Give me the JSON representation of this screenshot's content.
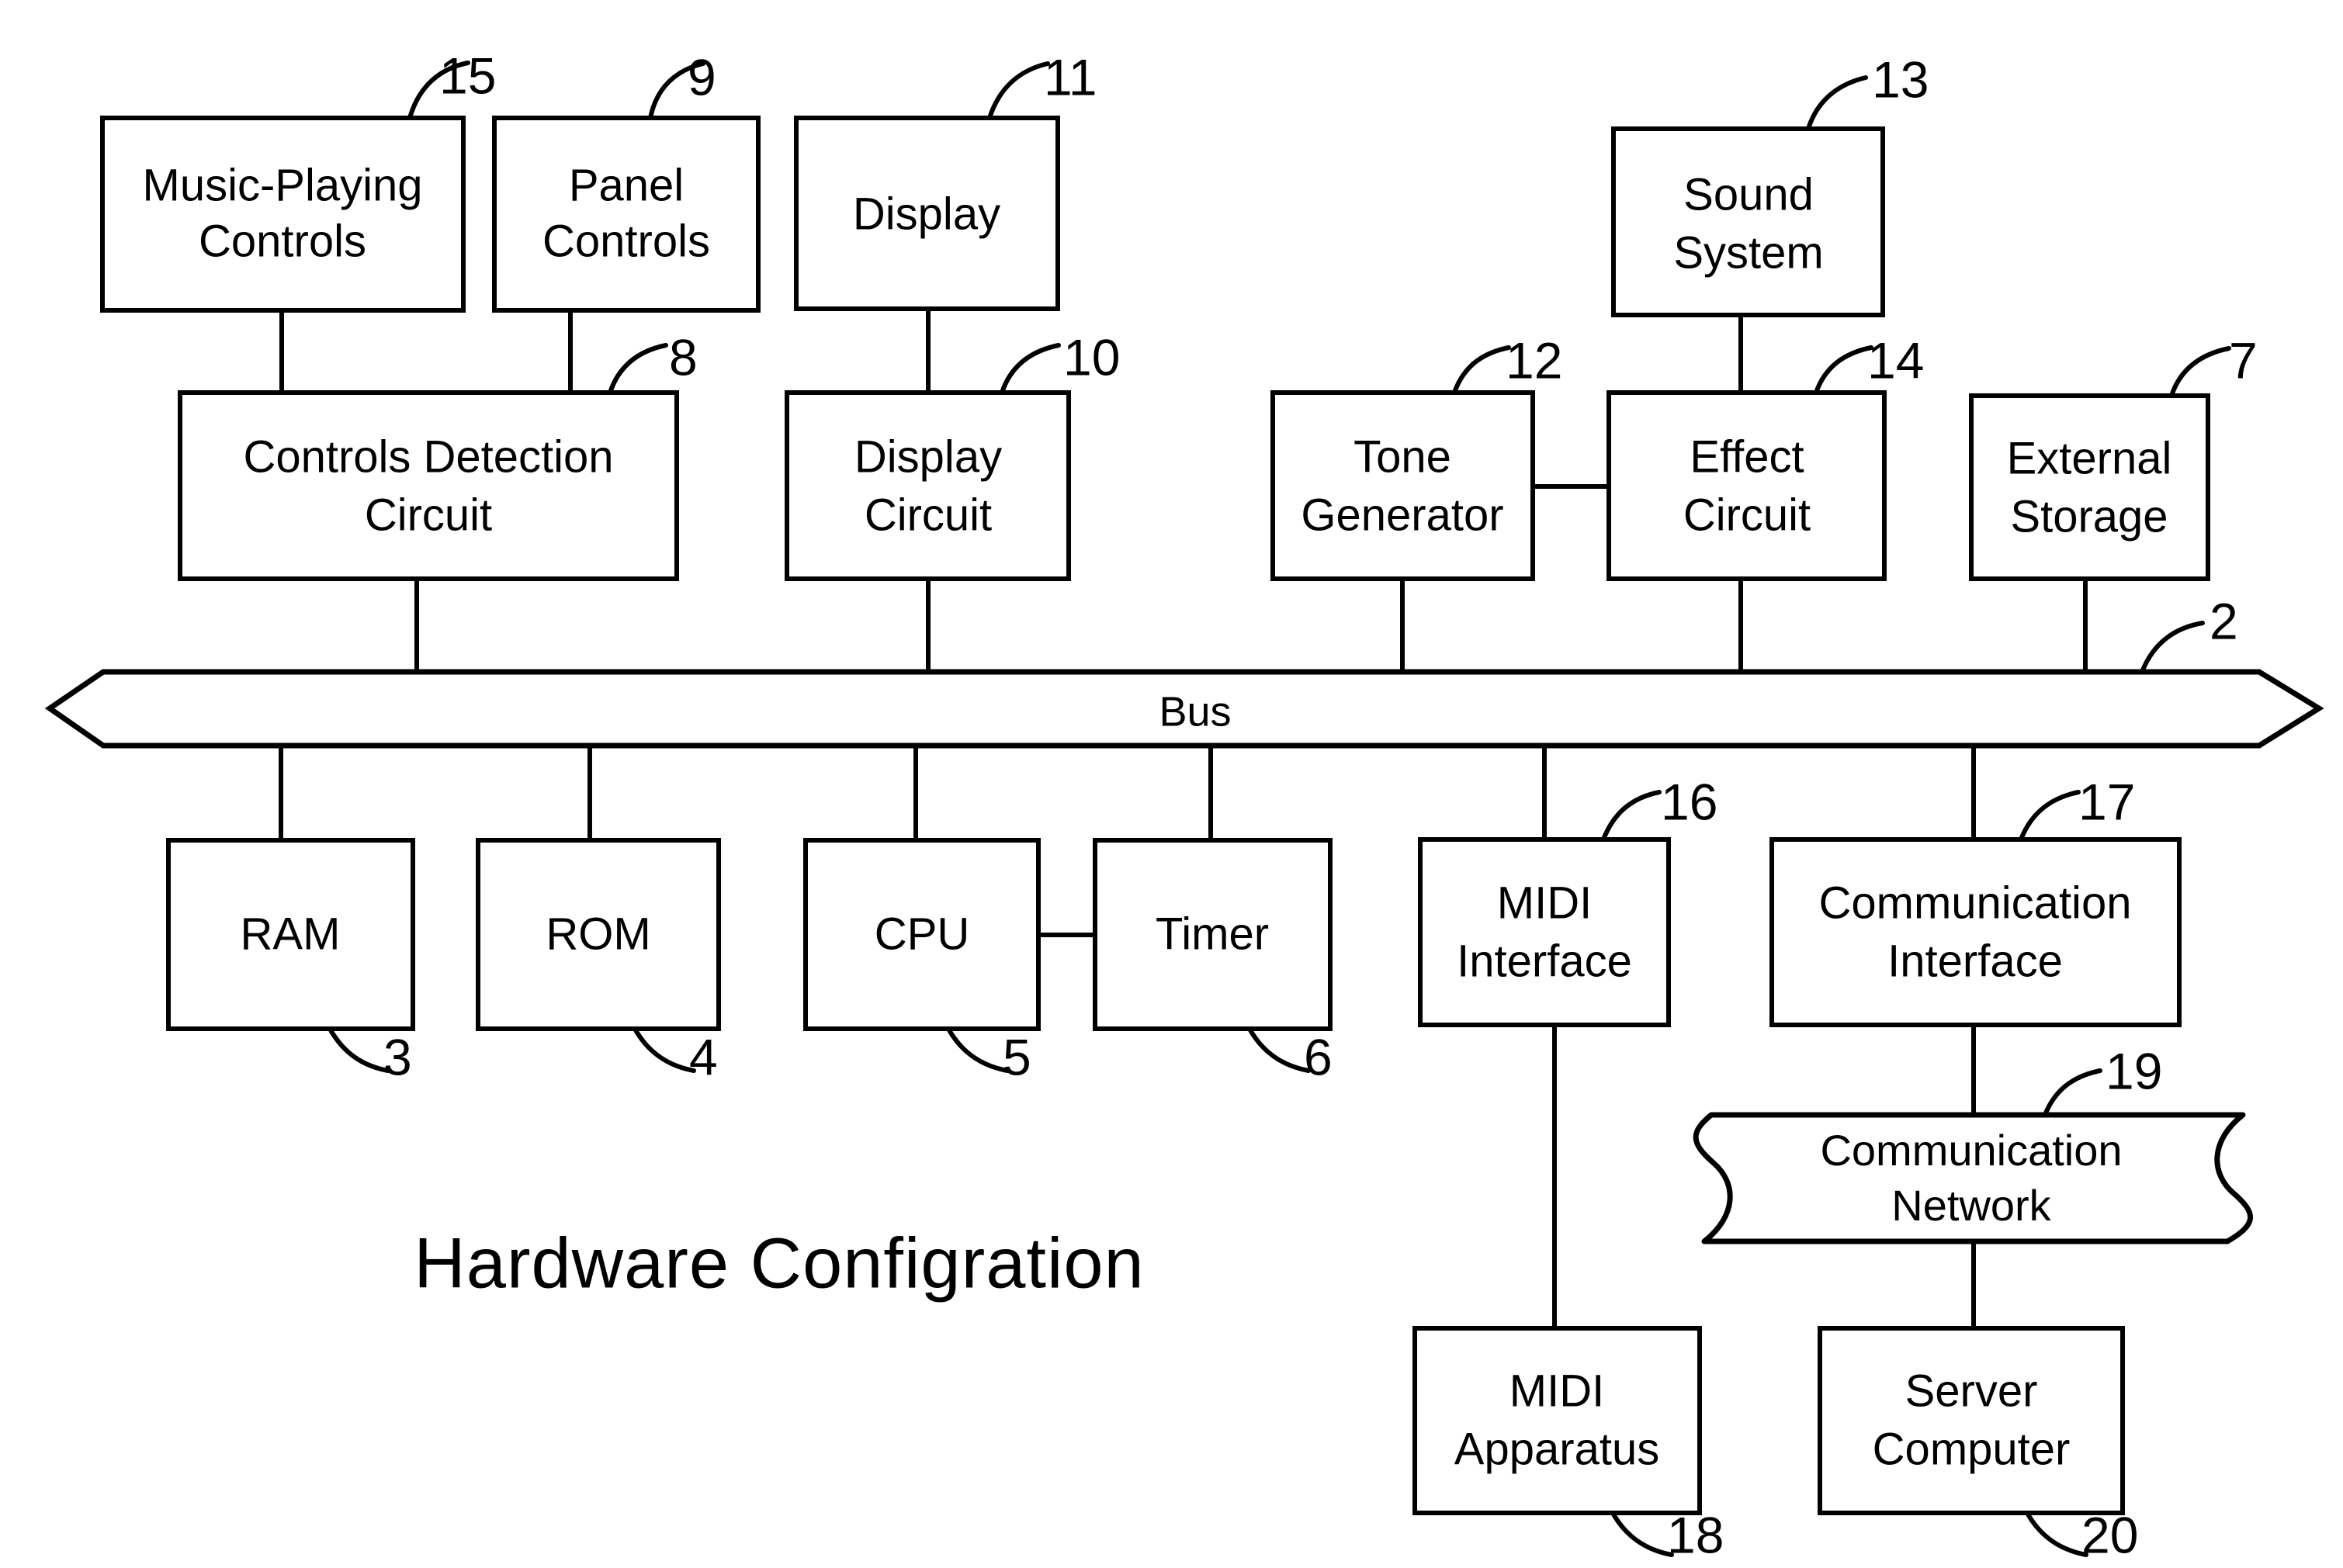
{
  "figure": {
    "caption": "Hardware Configration",
    "stroke_color": "#000000",
    "background_color": "#ffffff"
  },
  "bus": {
    "label": "Bus",
    "ref": "2"
  },
  "network": {
    "label_line1": "Communication",
    "label_line2": "Network",
    "ref": "19"
  },
  "blocks": [
    {
      "id": "music_playing_controls",
      "line1": "Music-Playing",
      "line2": "Controls",
      "ref": "15"
    },
    {
      "id": "panel_controls",
      "line1": "Panel",
      "line2": "Controls",
      "ref": "9"
    },
    {
      "id": "display",
      "line1": "Display",
      "line2": "",
      "ref": "11"
    },
    {
      "id": "sound_system",
      "line1": "Sound",
      "line2": "System",
      "ref": "13"
    },
    {
      "id": "controls_detection_circuit",
      "line1": "Controls Detection",
      "line2": "Circuit",
      "ref": "8"
    },
    {
      "id": "display_circuit",
      "line1": "Display",
      "line2": "Circuit",
      "ref": "10"
    },
    {
      "id": "tone_generator",
      "line1": "Tone",
      "line2": "Generator",
      "ref": "12"
    },
    {
      "id": "effect_circuit",
      "line1": "Effect",
      "line2": "Circuit",
      "ref": "14"
    },
    {
      "id": "external_storage",
      "line1": "External",
      "line2": "Storage",
      "ref": "7"
    },
    {
      "id": "ram",
      "line1": "RAM",
      "line2": "",
      "ref": "3"
    },
    {
      "id": "rom",
      "line1": "ROM",
      "line2": "",
      "ref": "4"
    },
    {
      "id": "cpu",
      "line1": "CPU",
      "line2": "",
      "ref": "5"
    },
    {
      "id": "timer",
      "line1": "Timer",
      "line2": "",
      "ref": "6"
    },
    {
      "id": "midi_interface",
      "line1": "MIDI",
      "line2": "Interface",
      "ref": "16"
    },
    {
      "id": "communication_interface",
      "line1": "Communication",
      "line2": "Interface",
      "ref": "17"
    },
    {
      "id": "midi_apparatus",
      "line1": "MIDI",
      "line2": "Apparatus",
      "ref": "18"
    },
    {
      "id": "server_computer",
      "line1": "Server",
      "line2": "Computer",
      "ref": "20"
    }
  ],
  "labels": {
    "music_playing_controls_l1": "Music-Playing",
    "music_playing_controls_l2": "Controls",
    "music_playing_controls_ref": "15",
    "panel_controls_l1": "Panel",
    "panel_controls_l2": "Controls",
    "panel_controls_ref": "9",
    "display_l1": "Display",
    "display_ref": "11",
    "sound_system_l1": "Sound",
    "sound_system_l2": "System",
    "sound_system_ref": "13",
    "controls_detection_l1": "Controls Detection",
    "controls_detection_l2": "Circuit",
    "controls_detection_ref": "8",
    "display_circuit_l1": "Display",
    "display_circuit_l2": "Circuit",
    "display_circuit_ref": "10",
    "tone_generator_l1": "Tone",
    "tone_generator_l2": "Generator",
    "tone_generator_ref": "12",
    "effect_circuit_l1": "Effect",
    "effect_circuit_l2": "Circuit",
    "effect_circuit_ref": "14",
    "external_storage_l1": "External",
    "external_storage_l2": "Storage",
    "external_storage_ref": "7",
    "ram_l1": "RAM",
    "ram_ref": "3",
    "rom_l1": "ROM",
    "rom_ref": "4",
    "cpu_l1": "CPU",
    "cpu_ref": "5",
    "timer_l1": "Timer",
    "timer_ref": "6",
    "midi_interface_l1": "MIDI",
    "midi_interface_l2": "Interface",
    "midi_interface_ref": "16",
    "communication_interface_l1": "Communication",
    "communication_interface_l2": "Interface",
    "communication_interface_ref": "17",
    "midi_apparatus_l1": "MIDI",
    "midi_apparatus_l2": "Apparatus",
    "midi_apparatus_ref": "18",
    "server_computer_l1": "Server",
    "server_computer_l2": "Computer",
    "server_computer_ref": "20",
    "bus_label": "Bus",
    "bus_ref": "2",
    "network_l1": "Communication",
    "network_l2": "Network",
    "network_ref": "19",
    "caption": "Hardware Configration"
  }
}
